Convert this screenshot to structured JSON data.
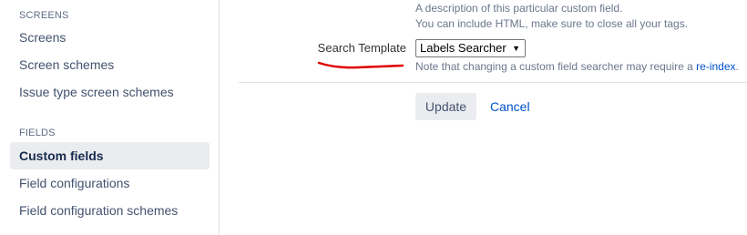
{
  "sidebar": {
    "sections": [
      {
        "title": "SCREENS",
        "items": [
          "Screens",
          "Screen schemes",
          "Issue type screen schemes"
        ]
      },
      {
        "title": "FIELDS",
        "items": [
          "Custom fields",
          "Field configurations",
          "Field configuration schemes"
        ]
      }
    ],
    "active_item": "Custom fields"
  },
  "form": {
    "description_line1": "A description of this particular custom field.",
    "description_line2": "You can include HTML, make sure to close all your tags.",
    "search_template_label": "Search Template",
    "search_template_value": "Labels Searcher",
    "note_text": "Note that changing a custom field searcher may require a ",
    "note_link": "re-index",
    "note_end": ".",
    "update_label": "Update",
    "cancel_label": "Cancel"
  },
  "colors": {
    "link": "#0052cc",
    "annotation": "#e00000",
    "active_bg": "#ebecf0"
  }
}
